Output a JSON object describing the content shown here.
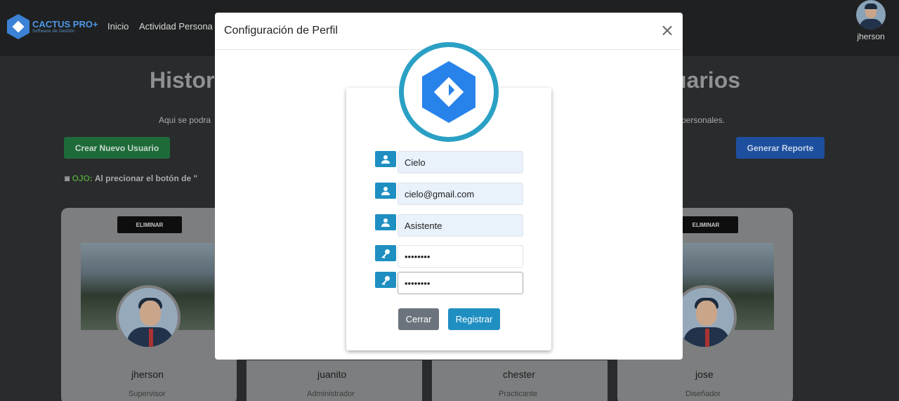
{
  "nav": {
    "brand_name": "CACTUS PRO+",
    "brand_sub": "Software de Gestión",
    "links": [
      "Inicio",
      "Actividad Persona"
    ],
    "user_name": "jherson"
  },
  "background": {
    "title_left": "Histor",
    "title_right": "uarios",
    "subtitle_left": "Aqui se podra",
    "subtitle_right": "personales.",
    "create_button": "Crear Nuevo Usuario",
    "report_button": "Generar Reporte",
    "note_prefix": "OJO:",
    "note_text": "Al precionar el botón de \"",
    "delete_label": "ELIMINAR",
    "cards": [
      {
        "name": "jherson",
        "role": "Supervisor"
      },
      {
        "name": "juanito",
        "role": "Administrador"
      },
      {
        "name": "chester",
        "role": "Practicante"
      },
      {
        "name": "jose",
        "role": "Diseñador"
      }
    ]
  },
  "modal": {
    "title": "Configuración de Perfil",
    "close_symbol": "×",
    "fields": {
      "name": "Cielo",
      "email": "cielo@gmail.com",
      "role": "Asistente",
      "password": "••••••••",
      "password_confirm": "••••••••"
    },
    "close_button": "Cerrar",
    "submit_button": "Registrar"
  },
  "icons": {
    "user": "user-icon",
    "key": "key-icon",
    "close": "close-icon"
  },
  "colors": {
    "accent": "#1f8fc2",
    "logo_blue": "#2783ea",
    "ring": "#2aa0c4",
    "cancel_gray": "#6b747c"
  }
}
